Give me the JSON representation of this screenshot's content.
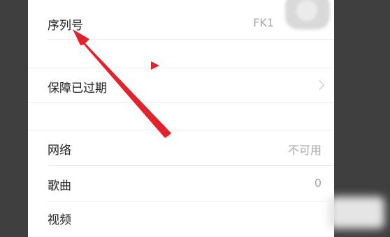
{
  "rows": [
    {
      "label": "序列号",
      "value": "FK1"
    },
    {
      "label": "保障已过期"
    },
    {
      "label": "网络",
      "value": "不可用"
    },
    {
      "label": "歌曲",
      "value": "0"
    },
    {
      "label": "视频"
    }
  ],
  "icons": {
    "chevron": "chevron-right-icon",
    "annotation": "red-arrow-icon"
  },
  "colors": {
    "background": "#3f3f3f",
    "panel": "#ffffff",
    "text": "#1e1e1e",
    "value_text": "#a6a6a6",
    "separator": "#ececec",
    "annotation": "#e2232b"
  }
}
